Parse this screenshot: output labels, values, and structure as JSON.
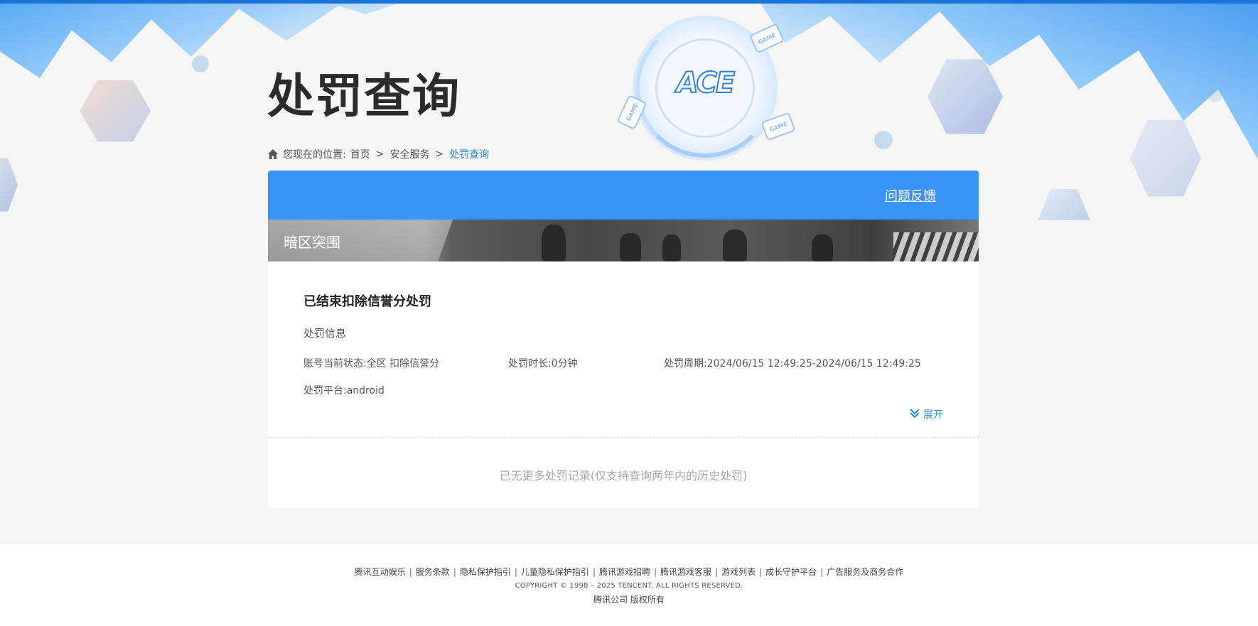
{
  "header": {
    "page_title": "处罚查询",
    "logo_text": "ACE",
    "game_tags": [
      "GAME",
      "GAME",
      "GAME"
    ]
  },
  "breadcrumb": {
    "prefix": "您现在的位置:",
    "items": [
      "首页",
      "安全服务",
      "处罚查询"
    ],
    "separator": ">"
  },
  "panel": {
    "feedback_label": "问题反馈",
    "game_name": "暗区突围",
    "record": {
      "title": "已结束扣除信誉分处罚",
      "subtitle": "处罚信息",
      "status": "账号当前状态:全区 扣除信誉分",
      "duration": "处罚时长:0分钟",
      "period": "处罚周期:2024/06/15 12:49:25-2024/06/15 12:49:25",
      "platform": "处罚平台:android",
      "expand_label": "展开"
    },
    "no_more_text": "已无更多处罚记录(仅支持查询两年内的历史处罚)"
  },
  "footer": {
    "links": [
      "腾讯互动娱乐",
      "服务条款",
      "隐私保护指引",
      "儿童隐私保护指引",
      "腾讯游戏招聘",
      "腾讯游戏客服",
      "游戏列表",
      "成长守护平台",
      "广告服务及商务合作"
    ],
    "copyright": "COPYRIGHT © 1998 – 2025 TENCENT. ALL RIGHTS RESERVED.",
    "rights": "腾讯公司 版权所有"
  },
  "colors": {
    "accent": "#3a94f7",
    "link": "#2b86e0",
    "topbar": "#1a73d9"
  }
}
